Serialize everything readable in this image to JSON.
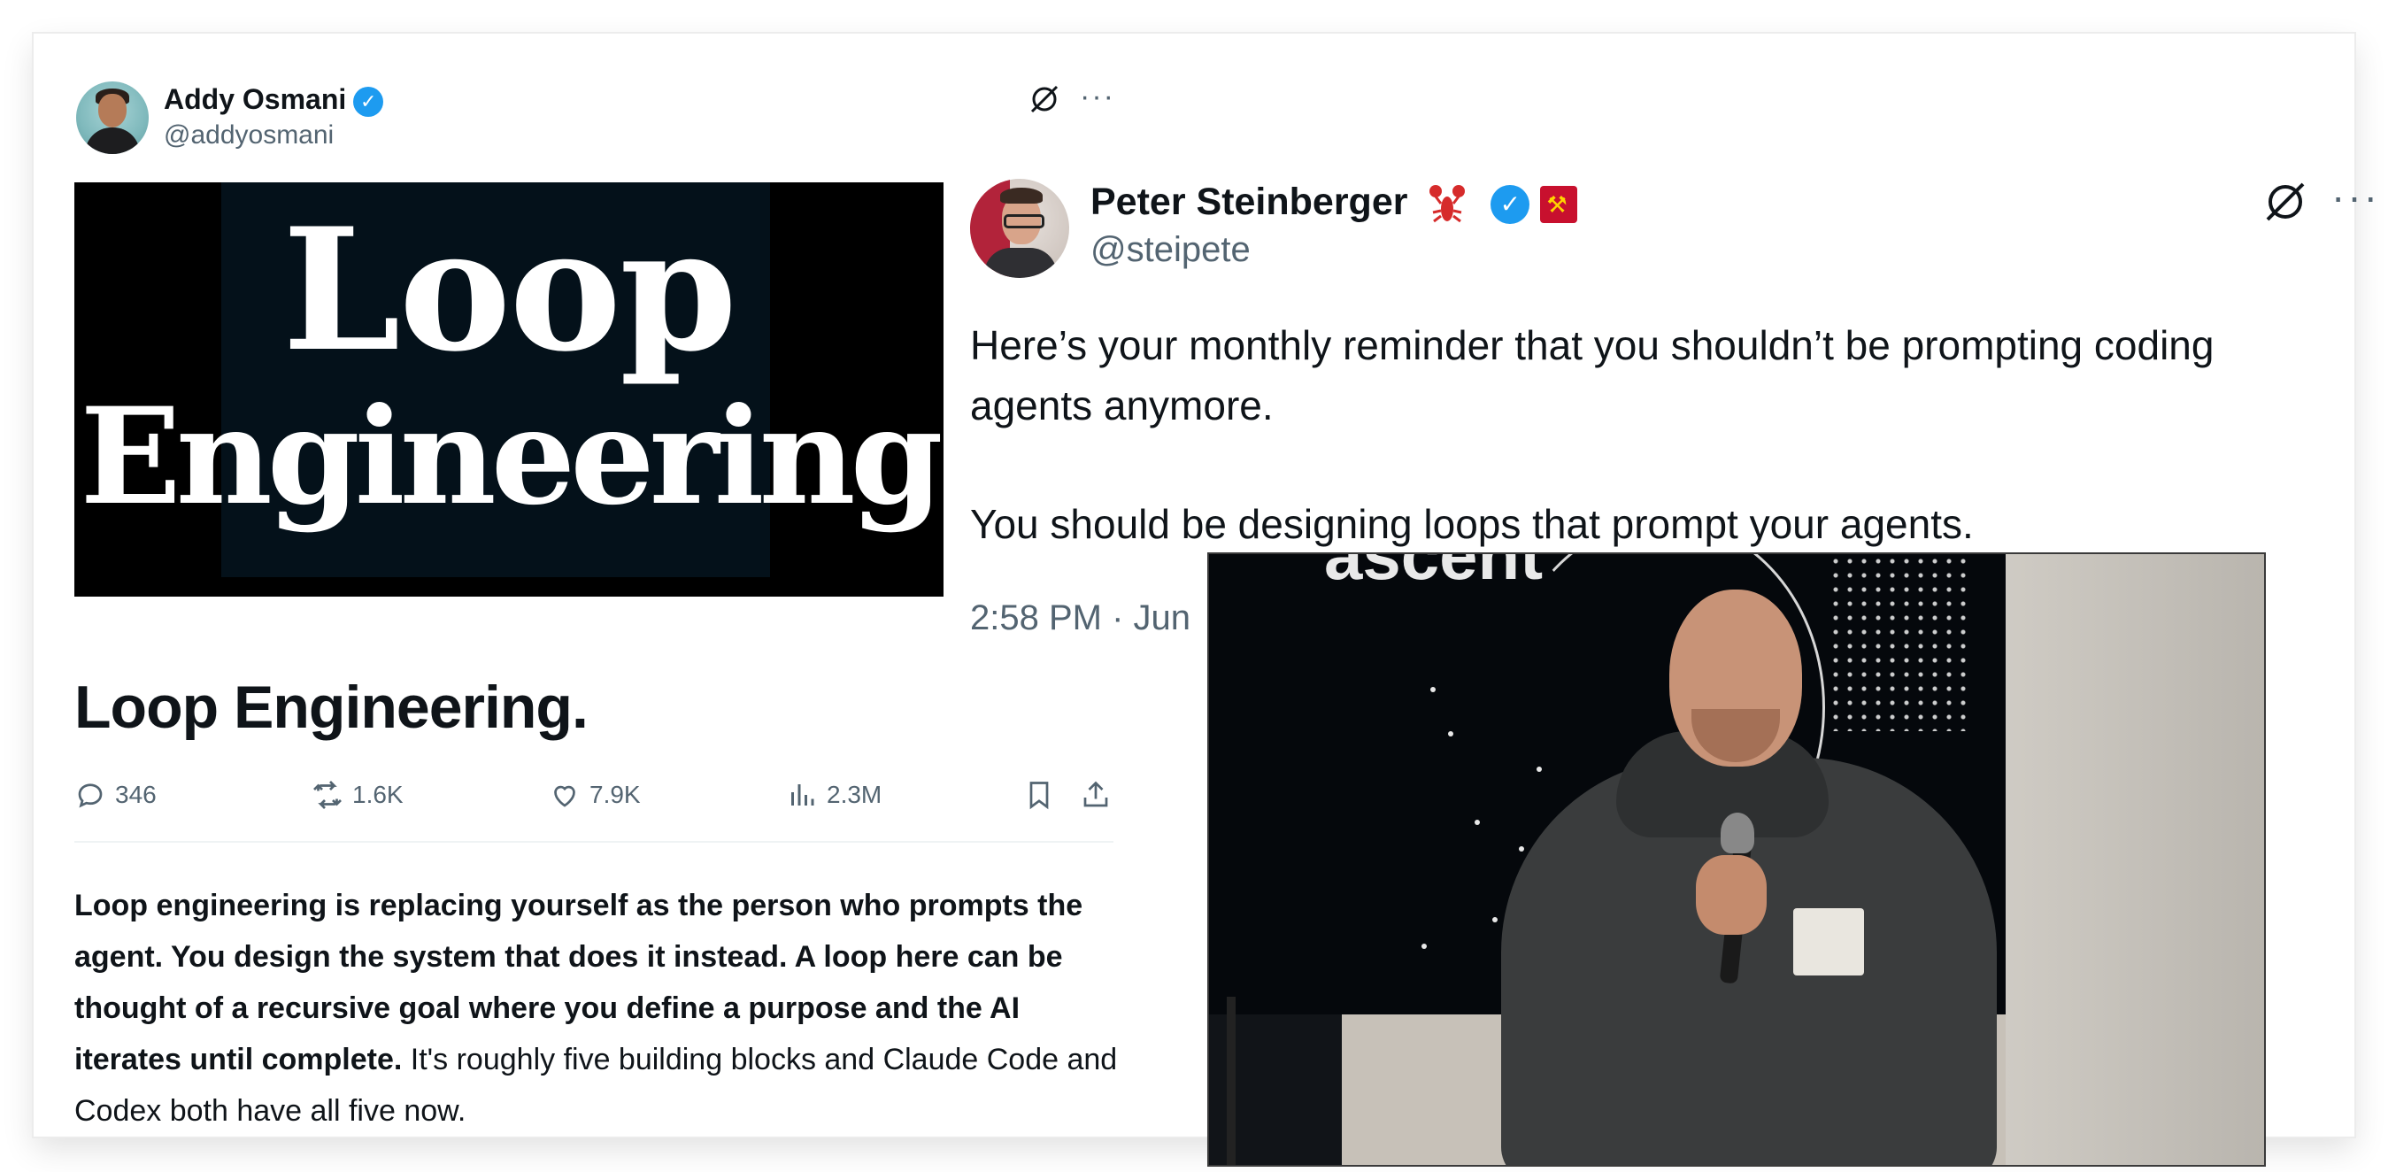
{
  "left_tweet": {
    "author_name": "Addy Osmani",
    "author_handle": "@addyosmani",
    "verified_mark": "✓",
    "more_label": "···",
    "banner": {
      "line1": "Loop",
      "line2": "Engineering"
    },
    "article_title": "Loop Engineering.",
    "stats": {
      "replies": "346",
      "reposts": "1.6K",
      "likes": "7.9K",
      "views": "2.3M"
    },
    "body_bold": "Loop engineering is replacing yourself as the person who prompts the agent. You design the system that does it instead. A loop here can be thought of a recursive goal where you define a purpose and the AI iterates until complete.",
    "body_regular": " It's roughly five building blocks and Claude Code and Codex both have all five now."
  },
  "right_tweet": {
    "author_name": "Peter Steinberger",
    "author_handle": "@steipete",
    "verified_mark": "✓",
    "flag_glyph": "⚒",
    "more_label": "···",
    "text_p1": "Here’s your monthly reminder that you shouldn’t be prompting coding agents anymore.",
    "text_p2": "You should be designing loops that prompt your agents.",
    "timestamp": "2:58 PM · Jun"
  },
  "video": {
    "backdrop_word": "ascent"
  },
  "colors": {
    "verified_blue": "#1d9bf0",
    "secondary_text": "#536471",
    "primary_text": "#0f1419"
  },
  "icons": [
    "grok-icon",
    "more-icon",
    "reply-icon",
    "repost-icon",
    "like-icon",
    "views-icon",
    "bookmark-icon",
    "share-icon",
    "lobster-icon"
  ]
}
